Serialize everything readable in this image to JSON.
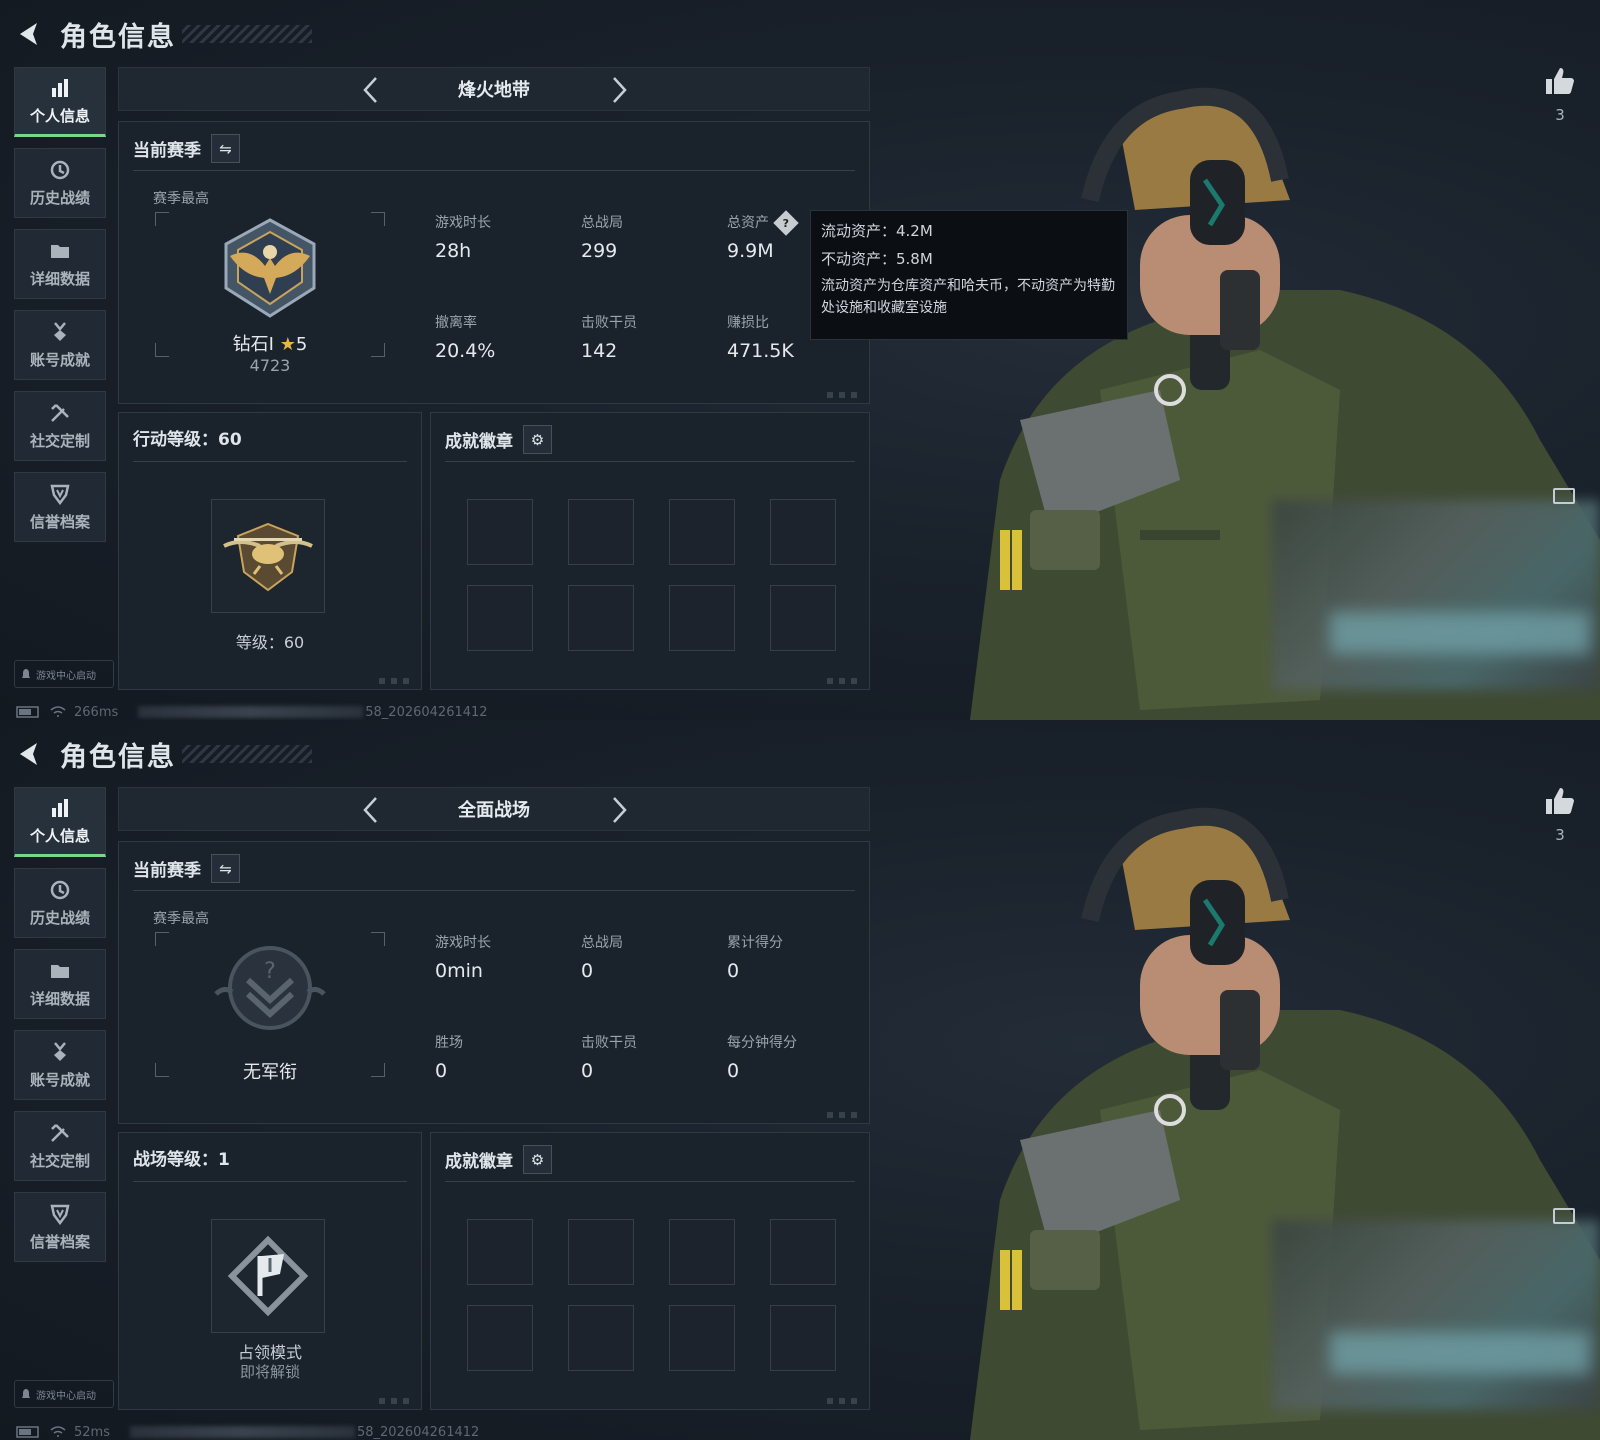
{
  "screens": [
    {
      "title": "角色信息",
      "nav": [
        "个人信息",
        "历史战绩",
        "详细数据",
        "账号成就",
        "社交定制",
        "信誉档案"
      ],
      "launch": "游戏中心启动",
      "ping": "266ms",
      "build": "58_202604261412",
      "mode": "烽火地带",
      "season": {
        "label": "当前赛季",
        "best": "赛季最高",
        "rank": "钻石Ⅰ",
        "stars": "5",
        "points": "4723"
      },
      "stats": [
        {
          "label": "游戏时长",
          "value": "28h"
        },
        {
          "label": "总战局",
          "value": "299"
        },
        {
          "label": "总资产",
          "value": "9.9M"
        },
        {
          "label": "撤离率",
          "value": "20.4%"
        },
        {
          "label": "击败干员",
          "value": "142"
        },
        {
          "label": "赚损比",
          "value": "471.5K"
        }
      ],
      "tooltip": {
        "line1": "流动资产：4.2M",
        "line2": "不动资产：5.8M",
        "note": "流动资产为仓库资产和哈夫币，不动资产为特勤处设施和收藏室设施"
      },
      "level": {
        "title": "行动等级：60",
        "caption": "等级：60"
      },
      "badges_title": "成就徽章",
      "likes": "3"
    },
    {
      "title": "角色信息",
      "nav": [
        "个人信息",
        "历史战绩",
        "详细数据",
        "账号成就",
        "社交定制",
        "信誉档案"
      ],
      "launch": "游戏中心启动",
      "ping": "52ms",
      "build": "58_202604261412",
      "mode": "全面战场",
      "season": {
        "label": "当前赛季",
        "best": "赛季最高",
        "rank": "无军衔"
      },
      "stats": [
        {
          "label": "游戏时长",
          "value": "0min"
        },
        {
          "label": "总战局",
          "value": "0"
        },
        {
          "label": "累计得分",
          "value": "0"
        },
        {
          "label": "胜场",
          "value": "0"
        },
        {
          "label": "击败干员",
          "value": "0"
        },
        {
          "label": "每分钟得分",
          "value": "0"
        }
      ],
      "level": {
        "title": "战场等级：1",
        "caption": "占领模式",
        "caption2": "即将解锁"
      },
      "badges_title": "成就徽章",
      "likes": "3"
    }
  ],
  "icons": [
    "back-arrow-icon",
    "bar-chart-icon",
    "clock-icon",
    "folder-icon",
    "medal-icon",
    "tools-icon",
    "shield-icon",
    "swap-icon",
    "gear-icon",
    "thumbs-up-icon",
    "share-icon",
    "battery-icon",
    "wifi-icon"
  ],
  "colors": {
    "accent_green": "#7ad689",
    "bg": "#161d26",
    "panel": "#1a222b"
  }
}
